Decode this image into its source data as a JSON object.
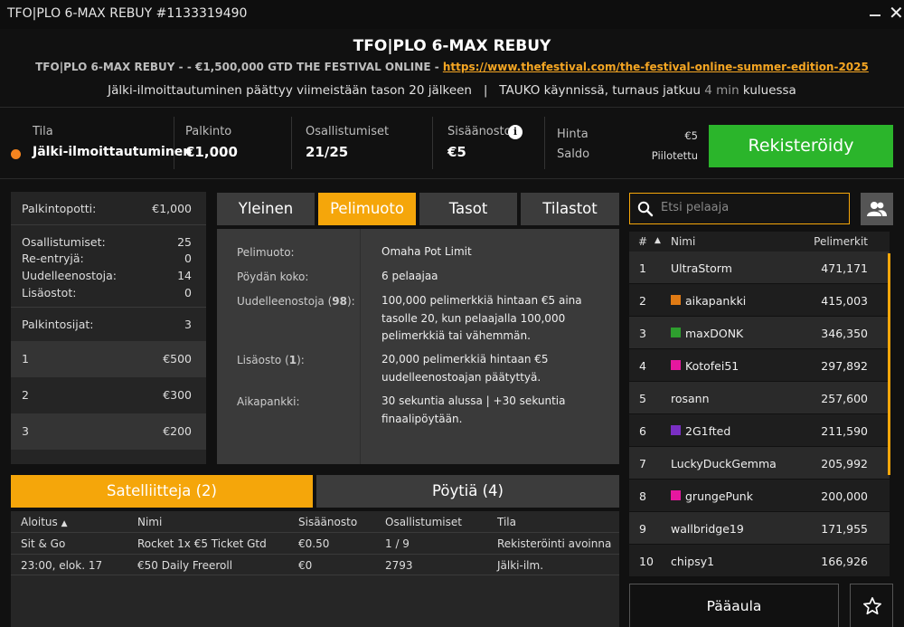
{
  "window": {
    "title": "TFO|PLO 6-MAX REBUY #1133319490"
  },
  "header": {
    "title": "TFO|PLO 6-MAX REBUY",
    "subtitle_prefix": "TFO|PLO 6-MAX REBUY - - €1,500,000 GTD THE FESTIVAL ONLINE - ",
    "subtitle_link": "https://www.thefestival.com/the-festival-online-summer-edition-2025",
    "notice_part1": "Jälki-ilmoittautuminen päättyy viimeistään tason 20 jälkeen",
    "notice_sep": "|",
    "notice_part2": "TAUKO käynnissä, turnaus jatkuu",
    "notice_time": "4 min",
    "notice_part3": "kuluessa"
  },
  "info": {
    "status_label": "Tila",
    "status_value": "Jälki-ilmoittautuminen",
    "status_color": "#f5841f",
    "prize_label": "Palkinto",
    "prize_value": "€1,000",
    "entries_label": "Osallistumiset",
    "entries_value": "21/25",
    "buyin_label": "Sisäänosto",
    "buyin_value": "€5",
    "price_label": "Hinta",
    "price_value": "€5",
    "balance_label": "Saldo",
    "balance_value": "Piilotettu",
    "register_label": "Rekisteröidy",
    "register_color": "#2bb52b"
  },
  "stats": {
    "prizepool_label": "Palkintopotti:",
    "prizepool_value": "€1,000",
    "entries_label": "Osallistumiset:",
    "entries_value": "25",
    "reentries_label": "Re-entryjä:",
    "reentries_value": "0",
    "rebuys_label": "Uudelleenostoja:",
    "rebuys_value": "14",
    "addons_label": "Lisäostot:",
    "addons_value": "0",
    "places_label": "Palkintosijat:",
    "places_value": "3",
    "prizes": [
      {
        "place": "1",
        "amount": "€500"
      },
      {
        "place": "2",
        "amount": "€300"
      },
      {
        "place": "3",
        "amount": "€200"
      }
    ]
  },
  "tabs": [
    {
      "label": "Yleinen",
      "active": false
    },
    {
      "label": "Pelimuoto",
      "active": true
    },
    {
      "label": "Tasot",
      "active": false
    },
    {
      "label": "Tilastot",
      "active": false
    }
  ],
  "details": {
    "game_label": "Pelimuoto:",
    "game_value": "Omaha Pot Limit",
    "table_label": "Pöydän koko:",
    "table_value": "6 pelaajaa",
    "rebuy_label_pre": "Uudelleenostoja (",
    "rebuy_count": "98",
    "rebuy_label_post": "):",
    "rebuy_value": "100,000 pelimerkkiä hintaan €5 aina tasolle 20, kun pelaajalla 100,000 pelimerkkiä tai vähemmän.",
    "addon_label_pre": "Lisäosto (",
    "addon_count": "1",
    "addon_label_post": "):",
    "addon_value": "20,000 pelimerkkiä hintaan €5 uudelleenostoajan päätyttyä.",
    "timebank_label": "Aikapankki:",
    "timebank_value": "30 sekuntia alussa | +30 sekuntia finaalipöytään."
  },
  "subtabs": [
    {
      "label": "Satelliitteja (2)",
      "active": true
    },
    {
      "label": "Pöytiä (4)",
      "active": false
    }
  ],
  "satellites": {
    "headers": [
      "Aloitus",
      "Nimi",
      "Sisäänosto",
      "Osallistumiset",
      "Tila"
    ],
    "sort_indicator": "▲",
    "rows": [
      {
        "start": "Sit & Go",
        "name": "Rocket 1x €5 Ticket Gtd",
        "buyin": "€0.50",
        "entries": "1 / 9",
        "status": "Rekisteröinti avoinna"
      },
      {
        "start": "23:00, elok. 17",
        "name": "€50 Daily Freeroll",
        "buyin": "€0",
        "entries": "2793",
        "status": "Jälki-ilm."
      }
    ]
  },
  "search": {
    "placeholder": "Etsi pelaaja"
  },
  "players": {
    "col_rank": "#",
    "sort_indicator": "▲",
    "col_name": "Nimi",
    "col_chips": "Pelimerkit",
    "rows": [
      {
        "rank": "1",
        "name": "UltraStorm",
        "chips": "471,171",
        "flag": ""
      },
      {
        "rank": "2",
        "name": "aikapankki",
        "chips": "415,003",
        "flag": "#e07b14"
      },
      {
        "rank": "3",
        "name": "maxDONK",
        "chips": "346,350",
        "flag": "#2e9e2e"
      },
      {
        "rank": "4",
        "name": "Kotofei51",
        "chips": "297,892",
        "flag": "#e6179f"
      },
      {
        "rank": "5",
        "name": "rosann",
        "chips": "257,600",
        "flag": ""
      },
      {
        "rank": "6",
        "name": "2G1fted",
        "chips": "211,590",
        "flag": "#7a2fc4"
      },
      {
        "rank": "7",
        "name": "LuckyDuckGemma",
        "chips": "205,992",
        "flag": ""
      },
      {
        "rank": "8",
        "name": "grungePunk",
        "chips": "200,000",
        "flag": "#e6179f"
      },
      {
        "rank": "9",
        "name": "wallbridge19",
        "chips": "171,955",
        "flag": ""
      },
      {
        "rank": "10",
        "name": "chipsy1",
        "chips": "166,926",
        "flag": ""
      }
    ]
  },
  "footer": {
    "lobby_label": "Pääaula",
    "fav_icon": "star-icon"
  },
  "colors": {
    "accent": "#f5a60a",
    "link": "#f5a623"
  }
}
